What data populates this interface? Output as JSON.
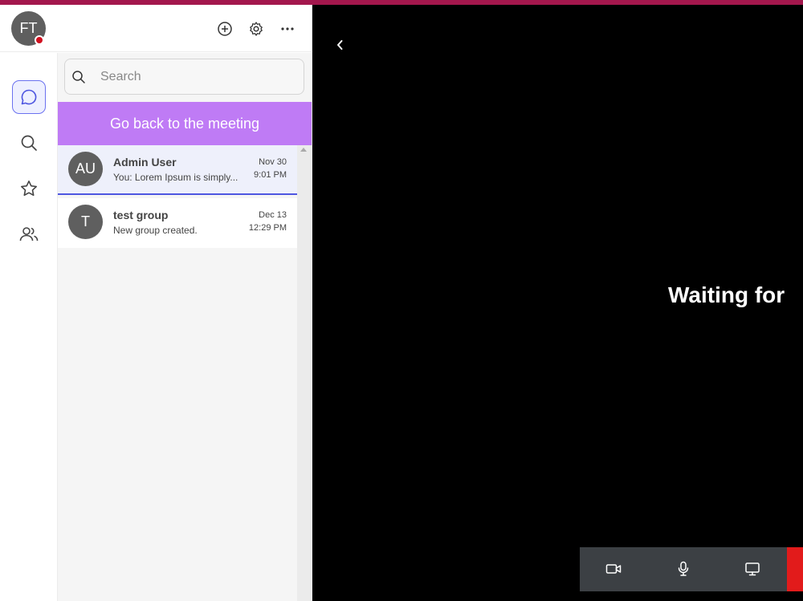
{
  "user": {
    "initials": "FT"
  },
  "search": {
    "placeholder": "Search"
  },
  "meeting_banner": {
    "label": "Go back to the meeting"
  },
  "chats": [
    {
      "initials": "AU",
      "name": "Admin User",
      "preview": "You: Lorem Ipsum is simply...",
      "date": "Nov 30",
      "time": "9:01 PM",
      "selected": true
    },
    {
      "initials": "T",
      "name": "test group",
      "preview": "New group created.",
      "date": "Dec 13",
      "time": "12:29 PM",
      "selected": false
    }
  ],
  "video": {
    "status_text": "Waiting for"
  },
  "icons": {
    "header": [
      "add-icon",
      "gear-icon",
      "more-icon"
    ],
    "rail": [
      "chat-icon",
      "search-icon",
      "star-icon",
      "contacts-icon"
    ],
    "controls": [
      "video-camera-icon",
      "microphone-icon",
      "screen-share-icon"
    ]
  },
  "colors": {
    "accent": "#4e56e0",
    "banner": "#bf7bf5",
    "top_bar": "#a3174d",
    "end_call": "#e21b1b",
    "status_busy": "#d1101f"
  }
}
